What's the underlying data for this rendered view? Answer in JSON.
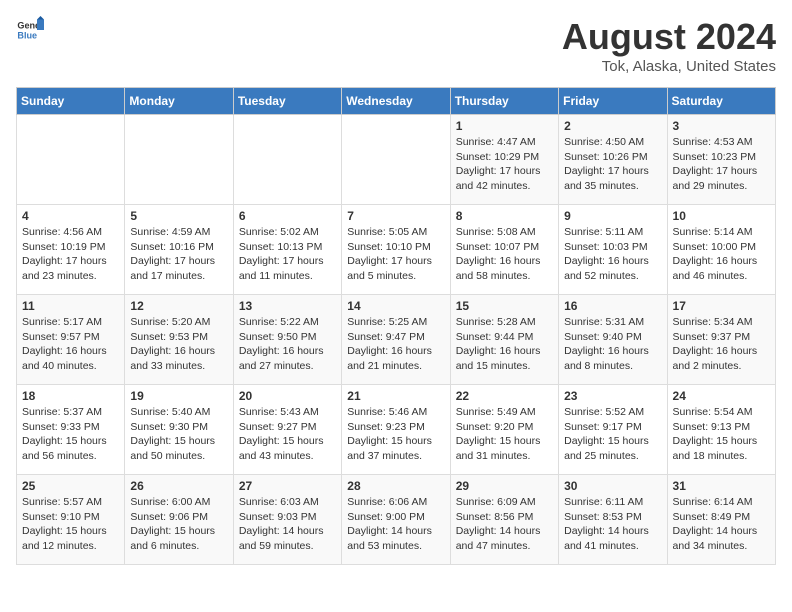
{
  "header": {
    "logo_general": "General",
    "logo_blue": "Blue",
    "main_title": "August 2024",
    "sub_title": "Tok, Alaska, United States"
  },
  "calendar": {
    "days_of_week": [
      "Sunday",
      "Monday",
      "Tuesday",
      "Wednesday",
      "Thursday",
      "Friday",
      "Saturday"
    ],
    "weeks": [
      [
        {
          "day": "",
          "info": ""
        },
        {
          "day": "",
          "info": ""
        },
        {
          "day": "",
          "info": ""
        },
        {
          "day": "",
          "info": ""
        },
        {
          "day": "1",
          "info": "Sunrise: 4:47 AM\nSunset: 10:29 PM\nDaylight: 17 hours\nand 42 minutes."
        },
        {
          "day": "2",
          "info": "Sunrise: 4:50 AM\nSunset: 10:26 PM\nDaylight: 17 hours\nand 35 minutes."
        },
        {
          "day": "3",
          "info": "Sunrise: 4:53 AM\nSunset: 10:23 PM\nDaylight: 17 hours\nand 29 minutes."
        }
      ],
      [
        {
          "day": "4",
          "info": "Sunrise: 4:56 AM\nSunset: 10:19 PM\nDaylight: 17 hours\nand 23 minutes."
        },
        {
          "day": "5",
          "info": "Sunrise: 4:59 AM\nSunset: 10:16 PM\nDaylight: 17 hours\nand 17 minutes."
        },
        {
          "day": "6",
          "info": "Sunrise: 5:02 AM\nSunset: 10:13 PM\nDaylight: 17 hours\nand 11 minutes."
        },
        {
          "day": "7",
          "info": "Sunrise: 5:05 AM\nSunset: 10:10 PM\nDaylight: 17 hours\nand 5 minutes."
        },
        {
          "day": "8",
          "info": "Sunrise: 5:08 AM\nSunset: 10:07 PM\nDaylight: 16 hours\nand 58 minutes."
        },
        {
          "day": "9",
          "info": "Sunrise: 5:11 AM\nSunset: 10:03 PM\nDaylight: 16 hours\nand 52 minutes."
        },
        {
          "day": "10",
          "info": "Sunrise: 5:14 AM\nSunset: 10:00 PM\nDaylight: 16 hours\nand 46 minutes."
        }
      ],
      [
        {
          "day": "11",
          "info": "Sunrise: 5:17 AM\nSunset: 9:57 PM\nDaylight: 16 hours\nand 40 minutes."
        },
        {
          "day": "12",
          "info": "Sunrise: 5:20 AM\nSunset: 9:53 PM\nDaylight: 16 hours\nand 33 minutes."
        },
        {
          "day": "13",
          "info": "Sunrise: 5:22 AM\nSunset: 9:50 PM\nDaylight: 16 hours\nand 27 minutes."
        },
        {
          "day": "14",
          "info": "Sunrise: 5:25 AM\nSunset: 9:47 PM\nDaylight: 16 hours\nand 21 minutes."
        },
        {
          "day": "15",
          "info": "Sunrise: 5:28 AM\nSunset: 9:44 PM\nDaylight: 16 hours\nand 15 minutes."
        },
        {
          "day": "16",
          "info": "Sunrise: 5:31 AM\nSunset: 9:40 PM\nDaylight: 16 hours\nand 8 minutes."
        },
        {
          "day": "17",
          "info": "Sunrise: 5:34 AM\nSunset: 9:37 PM\nDaylight: 16 hours\nand 2 minutes."
        }
      ],
      [
        {
          "day": "18",
          "info": "Sunrise: 5:37 AM\nSunset: 9:33 PM\nDaylight: 15 hours\nand 56 minutes."
        },
        {
          "day": "19",
          "info": "Sunrise: 5:40 AM\nSunset: 9:30 PM\nDaylight: 15 hours\nand 50 minutes."
        },
        {
          "day": "20",
          "info": "Sunrise: 5:43 AM\nSunset: 9:27 PM\nDaylight: 15 hours\nand 43 minutes."
        },
        {
          "day": "21",
          "info": "Sunrise: 5:46 AM\nSunset: 9:23 PM\nDaylight: 15 hours\nand 37 minutes."
        },
        {
          "day": "22",
          "info": "Sunrise: 5:49 AM\nSunset: 9:20 PM\nDaylight: 15 hours\nand 31 minutes."
        },
        {
          "day": "23",
          "info": "Sunrise: 5:52 AM\nSunset: 9:17 PM\nDaylight: 15 hours\nand 25 minutes."
        },
        {
          "day": "24",
          "info": "Sunrise: 5:54 AM\nSunset: 9:13 PM\nDaylight: 15 hours\nand 18 minutes."
        }
      ],
      [
        {
          "day": "25",
          "info": "Sunrise: 5:57 AM\nSunset: 9:10 PM\nDaylight: 15 hours\nand 12 minutes."
        },
        {
          "day": "26",
          "info": "Sunrise: 6:00 AM\nSunset: 9:06 PM\nDaylight: 15 hours\nand 6 minutes."
        },
        {
          "day": "27",
          "info": "Sunrise: 6:03 AM\nSunset: 9:03 PM\nDaylight: 14 hours\nand 59 minutes."
        },
        {
          "day": "28",
          "info": "Sunrise: 6:06 AM\nSunset: 9:00 PM\nDaylight: 14 hours\nand 53 minutes."
        },
        {
          "day": "29",
          "info": "Sunrise: 6:09 AM\nSunset: 8:56 PM\nDaylight: 14 hours\nand 47 minutes."
        },
        {
          "day": "30",
          "info": "Sunrise: 6:11 AM\nSunset: 8:53 PM\nDaylight: 14 hours\nand 41 minutes."
        },
        {
          "day": "31",
          "info": "Sunrise: 6:14 AM\nSunset: 8:49 PM\nDaylight: 14 hours\nand 34 minutes."
        }
      ]
    ]
  }
}
